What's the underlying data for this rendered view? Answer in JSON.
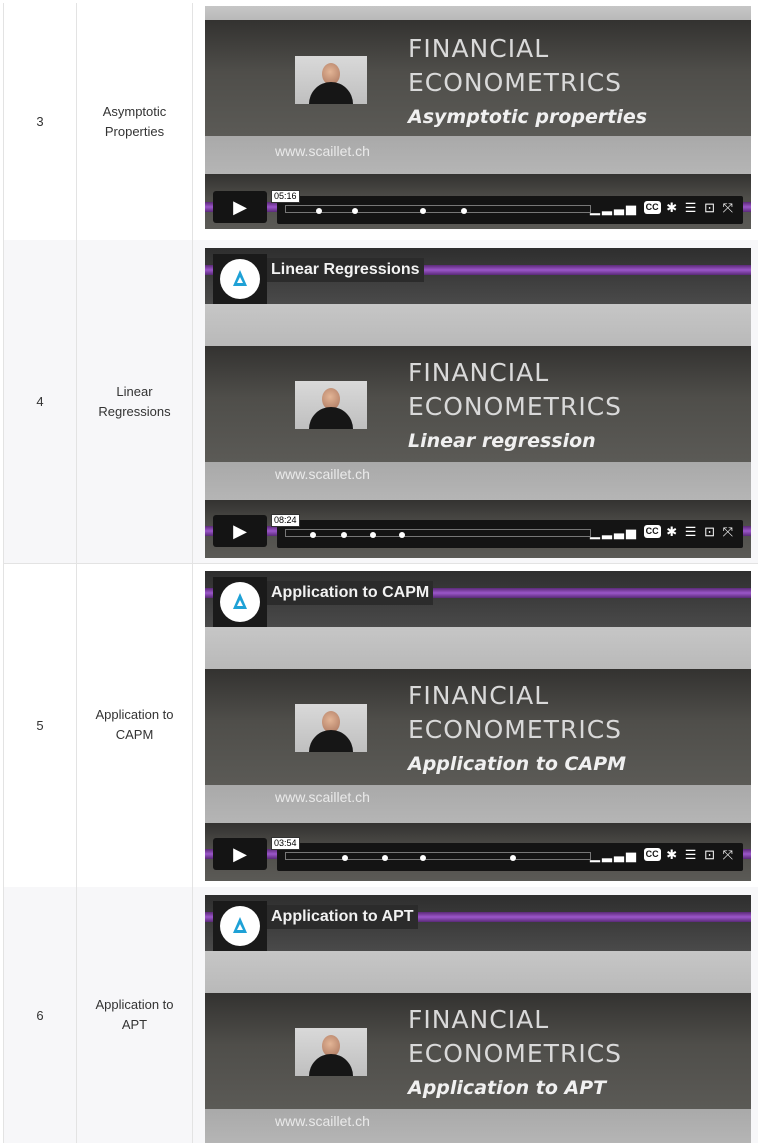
{
  "rows": [
    {
      "number": "3",
      "title_line1": "Asymptotic",
      "title_line2": "Properties",
      "video": {
        "heading_line1": "FINANCIAL",
        "heading_line2": "ECONOMETRICS",
        "subtitle": "Asymptotic properties",
        "url": "www.scaillet.ch",
        "timestamp": "05:16"
      }
    },
    {
      "number": "4",
      "title_line1": "Linear",
      "title_line2": "Regressions",
      "video": {
        "overlay_title": "Linear Regressions",
        "heading_line1": "FINANCIAL",
        "heading_line2": "ECONOMETRICS",
        "subtitle": "Linear regression",
        "url": "www.scaillet.ch",
        "timestamp": "08:24"
      }
    },
    {
      "number": "5",
      "title_line1": "Application to",
      "title_line2": "CAPM",
      "video": {
        "overlay_title": "Application to CAPM",
        "heading_line1": "FINANCIAL",
        "heading_line2": "ECONOMETRICS",
        "subtitle": "Application to CAPM",
        "url": "www.scaillet.ch",
        "timestamp": "03:54"
      }
    },
    {
      "number": "6",
      "title_line1": "Application to",
      "title_line2": "APT",
      "video": {
        "overlay_title": "Application to APT",
        "heading_line1": "FINANCIAL",
        "heading_line2": "ECONOMETRICS",
        "subtitle": "Application to APT",
        "url": "www.scaillet.ch"
      }
    }
  ],
  "player_controls": {
    "play_icon": "play-icon",
    "volume_icon": "volume-icon",
    "cc_label": "CC",
    "settings_icon": "gear-icon",
    "chapters_icon": "list-icon",
    "airplay_icon": "airplay-icon",
    "fullscreen_icon": "fullscreen-icon"
  },
  "colors": {
    "purple_strip": "#9b56c9",
    "logo_blue": "#1ea1d6"
  }
}
